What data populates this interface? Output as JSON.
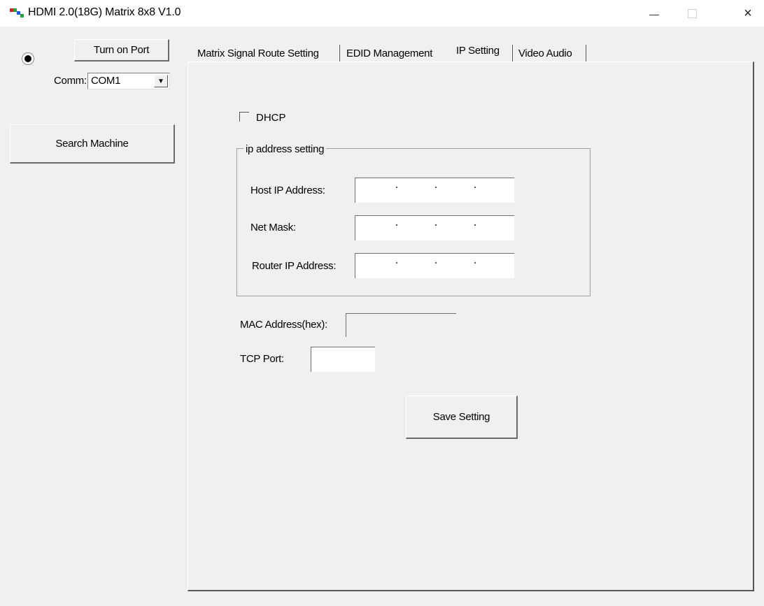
{
  "window": {
    "title": "HDMI 2.0(18G) Matrix 8x8 V1.0",
    "icon": "app-matrix-icon",
    "controls": {
      "minimize": "minimize-icon",
      "maximize": "maximize-icon",
      "close": "×"
    }
  },
  "left_panel": {
    "status_radio_selected": true,
    "turn_on_port_label": "Turn on Port",
    "comm_label": "Comm:",
    "comm_value": "COM1",
    "comm_arrow": "▼",
    "search_machine_label": "Search Machine"
  },
  "tabs": [
    {
      "label": "Matrix Signal Route Setting",
      "active": false
    },
    {
      "label": "EDID Management",
      "active": false
    },
    {
      "label": "IP Setting",
      "active": true
    },
    {
      "label": "Video Audio",
      "active": false
    }
  ],
  "ip_setting": {
    "dhcp_label": "DHCP",
    "dhcp_checked": false,
    "group_title": "ip address setting",
    "host_ip_label": "Host IP Address:",
    "host_ip_value": "",
    "net_mask_label": "Net Mask:",
    "net_mask_value": "",
    "router_ip_label": "Router IP Address:",
    "router_ip_value": "",
    "mac_label": "MAC Address(hex):",
    "mac_value": "",
    "tcp_port_label": "TCP Port:",
    "tcp_port_value": "",
    "save_label": "Save Setting"
  }
}
